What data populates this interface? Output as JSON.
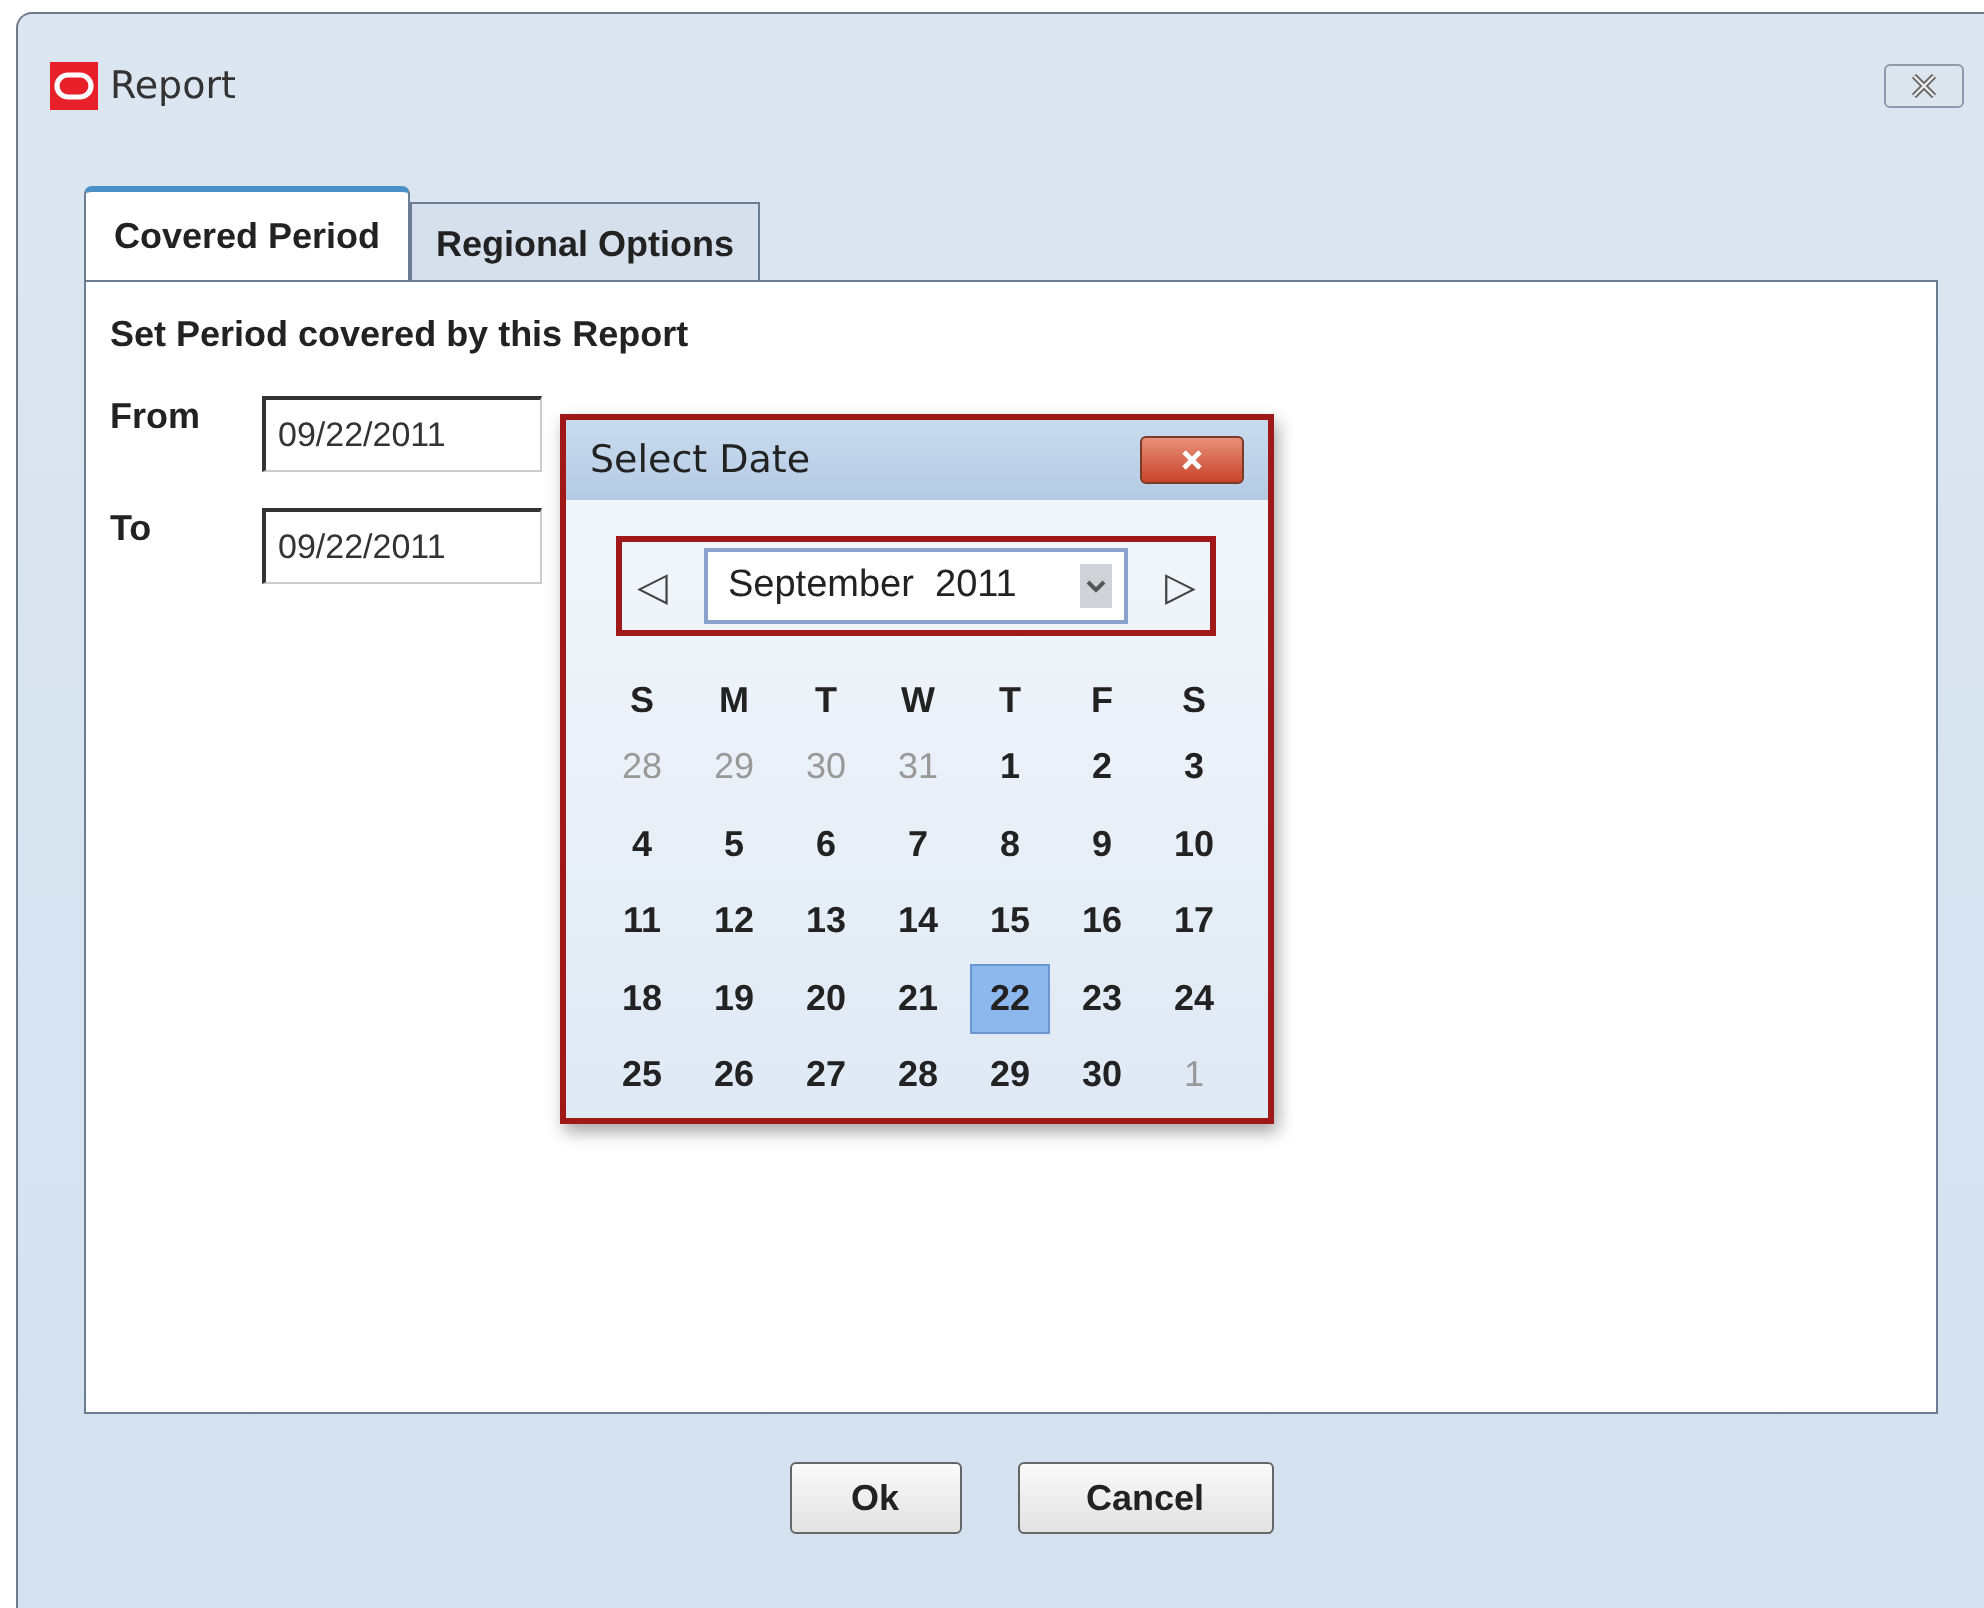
{
  "window": {
    "title": "Report"
  },
  "tabs": [
    {
      "label": "Covered Period",
      "selected": true
    },
    {
      "label": "Regional Options",
      "selected": false
    }
  ],
  "panel": {
    "heading": "Set Period covered by this Report",
    "fields": [
      {
        "label": "From",
        "value": "09/22/2011"
      },
      {
        "label": "To",
        "value": "09/22/2011"
      }
    ]
  },
  "date_picker": {
    "title": "Select Date",
    "highlighted": true,
    "month_highlighted": true,
    "prev": "◁",
    "next": "▷",
    "month": "September  2011",
    "weekdays": [
      "S",
      "M",
      "T",
      "W",
      "T",
      "F",
      "S"
    ],
    "weeks": [
      [
        {
          "day": "28",
          "muted": true,
          "selected": false
        },
        {
          "day": "29",
          "muted": true,
          "selected": false
        },
        {
          "day": "30",
          "muted": true,
          "selected": false
        },
        {
          "day": "31",
          "muted": true,
          "selected": false
        },
        {
          "day": "1",
          "muted": false,
          "selected": false
        },
        {
          "day": "2",
          "muted": false,
          "selected": false
        },
        {
          "day": "3",
          "muted": false,
          "selected": false
        }
      ],
      [
        {
          "day": "4",
          "muted": false,
          "selected": false
        },
        {
          "day": "5",
          "muted": false,
          "selected": false
        },
        {
          "day": "6",
          "muted": false,
          "selected": false
        },
        {
          "day": "7",
          "muted": false,
          "selected": false
        },
        {
          "day": "8",
          "muted": false,
          "selected": false
        },
        {
          "day": "9",
          "muted": false,
          "selected": false
        },
        {
          "day": "10",
          "muted": false,
          "selected": false
        }
      ],
      [
        {
          "day": "11",
          "muted": false,
          "selected": false
        },
        {
          "day": "12",
          "muted": false,
          "selected": false
        },
        {
          "day": "13",
          "muted": false,
          "selected": false
        },
        {
          "day": "14",
          "muted": false,
          "selected": false
        },
        {
          "day": "15",
          "muted": false,
          "selected": false
        },
        {
          "day": "16",
          "muted": false,
          "selected": false
        },
        {
          "day": "17",
          "muted": false,
          "selected": false
        }
      ],
      [
        {
          "day": "18",
          "muted": false,
          "selected": false
        },
        {
          "day": "19",
          "muted": false,
          "selected": false
        },
        {
          "day": "20",
          "muted": false,
          "selected": false
        },
        {
          "day": "21",
          "muted": false,
          "selected": false
        },
        {
          "day": "22",
          "muted": false,
          "selected": true
        },
        {
          "day": "23",
          "muted": false,
          "selected": false
        },
        {
          "day": "24",
          "muted": false,
          "selected": false
        }
      ],
      [
        {
          "day": "25",
          "muted": false,
          "selected": false
        },
        {
          "day": "26",
          "muted": false,
          "selected": false
        },
        {
          "day": "27",
          "muted": false,
          "selected": false
        },
        {
          "day": "28",
          "muted": false,
          "selected": false
        },
        {
          "day": "29",
          "muted": false,
          "selected": false
        },
        {
          "day": "30",
          "muted": false,
          "selected": false
        },
        {
          "day": "1",
          "muted": true,
          "selected": false
        }
      ]
    ]
  },
  "buttons": [
    "Ok",
    "Cancel"
  ]
}
